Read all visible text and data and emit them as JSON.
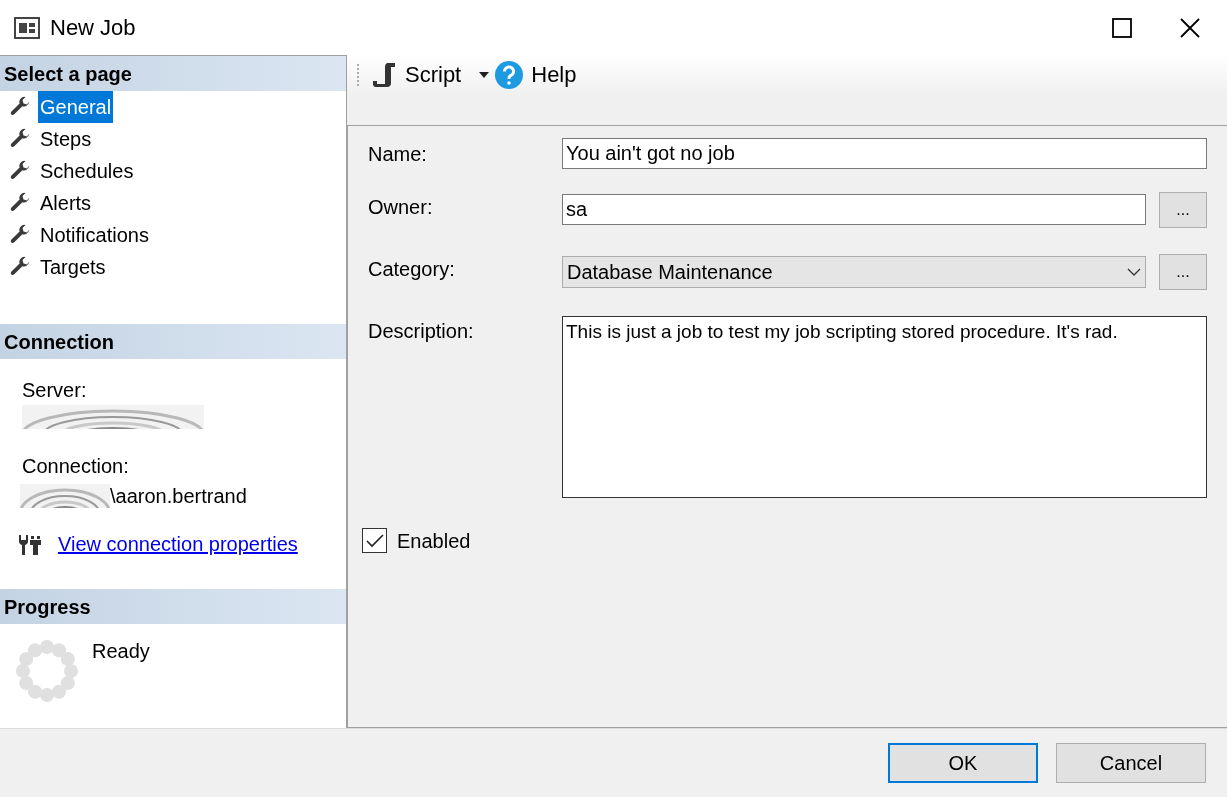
{
  "window": {
    "title": "New Job"
  },
  "sidebar": {
    "title": "Select a page",
    "items": [
      {
        "label": "General",
        "selected": true
      },
      {
        "label": "Steps",
        "selected": false
      },
      {
        "label": "Schedules",
        "selected": false
      },
      {
        "label": "Alerts",
        "selected": false
      },
      {
        "label": "Notifications",
        "selected": false
      },
      {
        "label": "Targets",
        "selected": false
      }
    ]
  },
  "connection": {
    "title": "Connection",
    "server_label": "Server:",
    "connection_label": "Connection:",
    "connection_value": "\\aaron.bertrand",
    "link": "View connection properties"
  },
  "progress": {
    "title": "Progress",
    "status": "Ready"
  },
  "toolbar": {
    "script": "Script",
    "help": "Help"
  },
  "form": {
    "name_label": "Name:",
    "name_value": "You ain't got no job",
    "owner_label": "Owner:",
    "owner_value": "sa",
    "category_label": "Category:",
    "category_value": "Database Maintenance",
    "description_label": "Description:",
    "description_value": "This is just a job to test my job scripting stored procedure. It's rad.",
    "browse": [
      "...",
      "..."
    ],
    "enabled_label": "Enabled",
    "enabled": true
  },
  "buttons": [
    "OK",
    "Cancel"
  ]
}
